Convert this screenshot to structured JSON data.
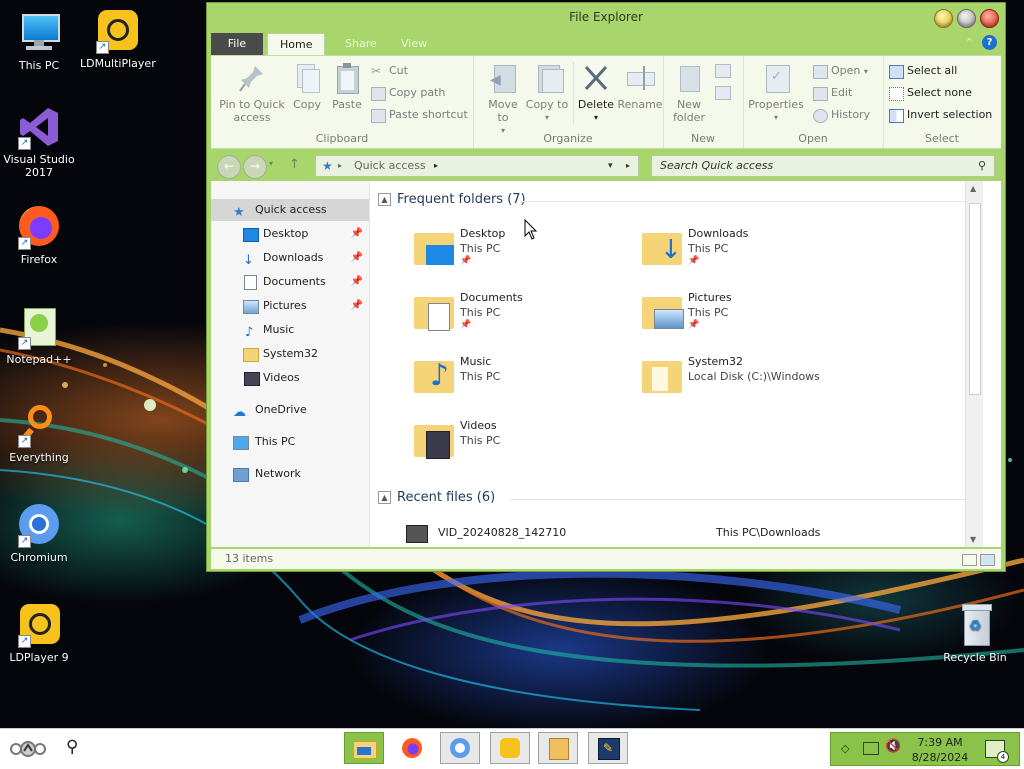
{
  "desktop": {
    "icons": [
      {
        "label": "This PC",
        "icon": "this-pc-icon"
      },
      {
        "label": "LDMultiPlayer",
        "icon": "ldmultiplayer-icon"
      },
      {
        "label": "Visual Studio 2017",
        "icon": "visual-studio-icon"
      },
      {
        "label": "Firefox",
        "icon": "firefox-icon"
      },
      {
        "label": "Notepad++",
        "icon": "notepadpp-icon"
      },
      {
        "label": "Everything",
        "icon": "everything-icon"
      },
      {
        "label": "Chromium",
        "icon": "chromium-icon"
      },
      {
        "label": "LDPlayer 9",
        "icon": "ldplayer-icon"
      },
      {
        "label": "Recycle Bin",
        "icon": "recycle-bin-icon"
      }
    ]
  },
  "window": {
    "title": "File Explorer",
    "tabs": {
      "file": "File",
      "home": "Home",
      "share": "Share",
      "view": "View"
    },
    "ribbon": {
      "clipboard": {
        "pin": "Pin to Quick access",
        "copy": "Copy",
        "paste": "Paste",
        "cut": "Cut",
        "copy_path": "Copy path",
        "paste_shortcut": "Paste shortcut",
        "label": "Clipboard"
      },
      "organize": {
        "move_to": "Move to",
        "copy_to": "Copy to",
        "delete": "Delete",
        "rename": "Rename",
        "label": "Organize"
      },
      "new": {
        "new_folder": "New folder",
        "label": "New"
      },
      "open": {
        "properties": "Properties",
        "open": "Open",
        "edit": "Edit",
        "history": "History",
        "label": "Open"
      },
      "select": {
        "select_all": "Select all",
        "select_none": "Select none",
        "invert": "Invert selection",
        "label": "Select"
      }
    },
    "address": {
      "path": "Quick access",
      "search_placeholder": "Search Quick access"
    },
    "nav": [
      {
        "label": "Quick access",
        "pinned": false
      },
      {
        "label": "Desktop",
        "pinned": true
      },
      {
        "label": "Downloads",
        "pinned": true
      },
      {
        "label": "Documents",
        "pinned": true
      },
      {
        "label": "Pictures",
        "pinned": true
      },
      {
        "label": "Music",
        "pinned": false
      },
      {
        "label": "System32",
        "pinned": false
      },
      {
        "label": "Videos",
        "pinned": false
      },
      {
        "label": "OneDrive",
        "pinned": false
      },
      {
        "label": "This PC",
        "pinned": false
      },
      {
        "label": "Network",
        "pinned": false
      }
    ],
    "frequent": {
      "header": "Frequent folders (7)",
      "folders": [
        {
          "name": "Desktop",
          "location": "This PC"
        },
        {
          "name": "Downloads",
          "location": "This PC"
        },
        {
          "name": "Documents",
          "location": "This PC"
        },
        {
          "name": "Pictures",
          "location": "This PC"
        },
        {
          "name": "Music",
          "location": "This PC"
        },
        {
          "name": "System32",
          "location": "Local Disk (C:)\\Windows"
        },
        {
          "name": "Videos",
          "location": "This PC"
        }
      ]
    },
    "recent": {
      "header": "Recent files (6)",
      "files": [
        {
          "name": "VID_20240828_142710",
          "location": "This PC\\Downloads"
        }
      ]
    },
    "status": "13 items"
  },
  "taskbar": {
    "time": "7:39 AM",
    "date": "8/28/2024",
    "notifications": "4"
  },
  "colors": {
    "accent": "#a9d66c",
    "taskbar_active": "#8bc34a",
    "file_tab": "#4a4a4a"
  }
}
